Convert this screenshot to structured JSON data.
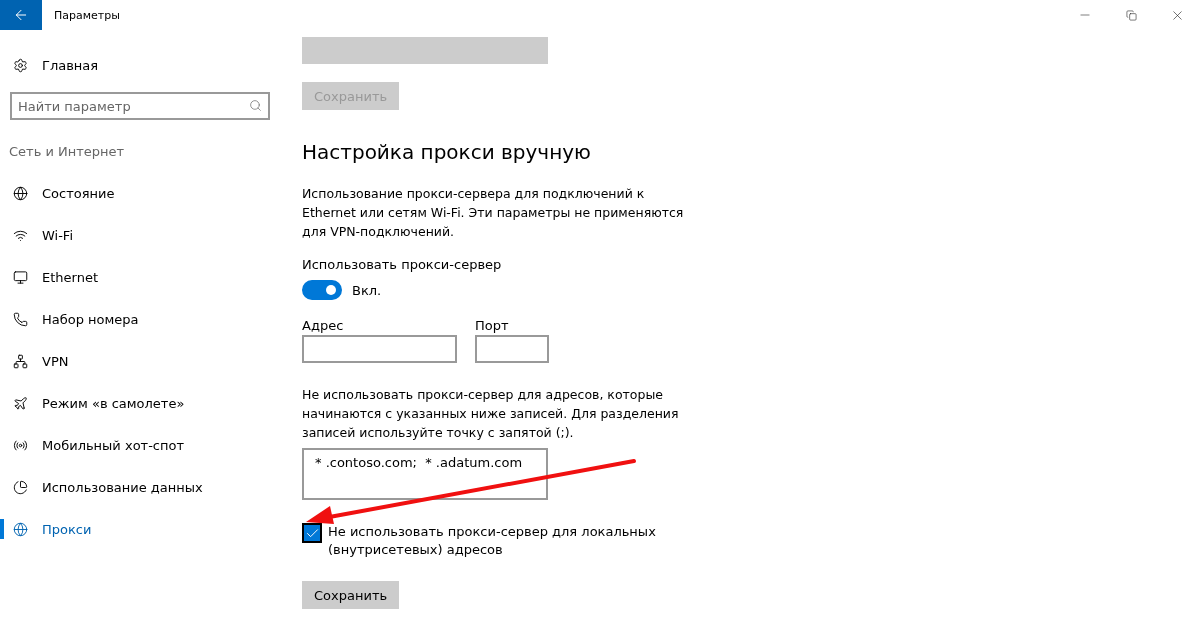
{
  "window": {
    "title": "Параметры"
  },
  "sidebar": {
    "home": {
      "label": "Главная"
    },
    "search": {
      "placeholder": "Найти параметр"
    },
    "section": "Сеть и Интернет",
    "items": [
      {
        "label": "Состояние",
        "selected": false
      },
      {
        "label": "Wi-Fi",
        "selected": false
      },
      {
        "label": "Ethernet",
        "selected": false
      },
      {
        "label": "Набор номера",
        "selected": false
      },
      {
        "label": "VPN",
        "selected": false
      },
      {
        "label": "Режим «в самолете»",
        "selected": false
      },
      {
        "label": "Мобильный хот-спот",
        "selected": false
      },
      {
        "label": "Использование данных",
        "selected": false
      },
      {
        "label": "Прокси",
        "selected": true
      }
    ]
  },
  "content": {
    "script_field": {
      "disabled": true
    },
    "script_save": {
      "label": "Сохранить",
      "disabled": true
    },
    "heading": "Настройка прокси вручную",
    "description": "Использование прокси-сервера для подключений к Ethernet или сетям Wi-Fi. Эти параметры не применяются для VPN-подключений.",
    "use_proxy": {
      "label": "Использовать прокси-сервер",
      "on": true,
      "state": "Вкл."
    },
    "address": {
      "label": "Адрес"
    },
    "port": {
      "label": "Порт"
    },
    "exceptions_text": "Не использовать прокси-сервер для адресов, которые начинаются с указанных ниже записей. Для разделения записей используйте точку с запятой (;).",
    "exceptions_value": "* .contoso.com;  * .adatum.com",
    "local_bypass": {
      "label": "Не использовать прокси-сервер для локальных (внутрисетевых) адресов",
      "checked": true
    },
    "save": {
      "label": "Сохранить",
      "disabled": false
    }
  }
}
